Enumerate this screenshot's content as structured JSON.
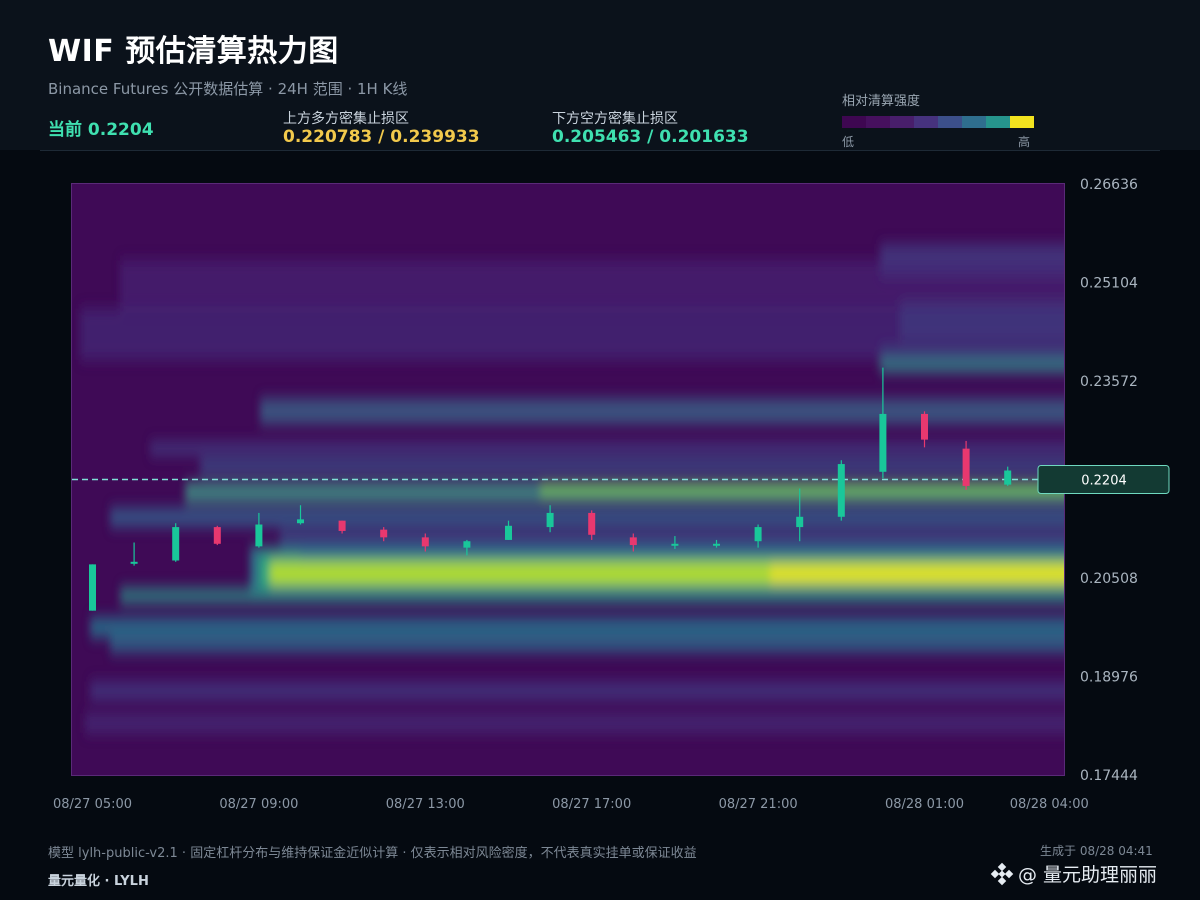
{
  "header": {
    "title": "WIF 预估清算热力图",
    "subtitle": "Binance Futures 公开数据估算 · 24H 范围 · 1H K线",
    "current": "当前 0.2204",
    "upper_zone_label": "上方多方密集止损区",
    "upper_zone_value": "0.220783 / 0.239933",
    "lower_zone_label": "下方空方密集止损区",
    "lower_zone_value": "0.205463 / 0.201633"
  },
  "legend": {
    "title": "相对清算强度",
    "low": "低",
    "high": "高",
    "colors": [
      "#3e0751",
      "#46105e",
      "#481e6b",
      "#46327e",
      "#3c4f8a",
      "#2f6e8e",
      "#26948c",
      "#f3e31f"
    ]
  },
  "colors": {
    "up_candle": "#19c79a",
    "down_candle": "#e8386f",
    "current_line": "#7fe0d6",
    "upper_zone_text": "#f2c94c",
    "lower_zone_text": "#3fe0b0"
  },
  "chart_data": {
    "type": "heatmap",
    "overlay": "candlestick",
    "ylim": [
      0.17444,
      0.26636
    ],
    "y_ticks": [
      "0.26636",
      "0.25104",
      "0.23572",
      "0.20508",
      "0.18976",
      "0.17444"
    ],
    "x_ticks": [
      "08/27 05:00",
      "08/27 09:00",
      "08/27 13:00",
      "08/27 17:00",
      "08/27 21:00",
      "08/28 01:00",
      "08/28 04:00"
    ],
    "x_range_hours": [
      0,
      23.5
    ],
    "current_price": 0.2204,
    "current_price_label": "0.2204",
    "candles": [
      {
        "o": 0.2,
        "h": 0.2072,
        "l": 0.2,
        "c": 0.2072
      },
      {
        "o": 0.2074,
        "h": 0.2106,
        "l": 0.207,
        "c": 0.2076
      },
      {
        "o": 0.2078,
        "h": 0.2136,
        "l": 0.2076,
        "c": 0.213
      },
      {
        "o": 0.213,
        "h": 0.2132,
        "l": 0.2102,
        "c": 0.2104
      },
      {
        "o": 0.21,
        "h": 0.2152,
        "l": 0.2098,
        "c": 0.2134
      },
      {
        "o": 0.2136,
        "h": 0.2164,
        "l": 0.2134,
        "c": 0.2142
      },
      {
        "o": 0.214,
        "h": 0.214,
        "l": 0.212,
        "c": 0.2124
      },
      {
        "o": 0.2126,
        "h": 0.213,
        "l": 0.2108,
        "c": 0.2114
      },
      {
        "o": 0.2114,
        "h": 0.212,
        "l": 0.2092,
        "c": 0.21
      },
      {
        "o": 0.2098,
        "h": 0.211,
        "l": 0.2086,
        "c": 0.2108
      },
      {
        "o": 0.211,
        "h": 0.214,
        "l": 0.211,
        "c": 0.2132
      },
      {
        "o": 0.213,
        "h": 0.2164,
        "l": 0.2122,
        "c": 0.2152
      },
      {
        "o": 0.2152,
        "h": 0.2156,
        "l": 0.211,
        "c": 0.2118
      },
      {
        "o": 0.2114,
        "h": 0.212,
        "l": 0.2092,
        "c": 0.2102
      },
      {
        "o": 0.2102,
        "h": 0.2116,
        "l": 0.2096,
        "c": 0.2104
      },
      {
        "o": 0.2102,
        "h": 0.211,
        "l": 0.2098,
        "c": 0.2104
      },
      {
        "o": 0.2108,
        "h": 0.2134,
        "l": 0.2098,
        "c": 0.213
      },
      {
        "o": 0.213,
        "h": 0.219,
        "l": 0.2108,
        "c": 0.2146
      },
      {
        "o": 0.2146,
        "h": 0.2234,
        "l": 0.214,
        "c": 0.2228
      },
      {
        "o": 0.2216,
        "h": 0.2378,
        "l": 0.2206,
        "c": 0.2306
      },
      {
        "o": 0.2306,
        "h": 0.231,
        "l": 0.2254,
        "c": 0.2266
      },
      {
        "o": 0.2252,
        "h": 0.2264,
        "l": 0.2188,
        "c": 0.2194
      },
      {
        "o": 0.2196,
        "h": 0.2224,
        "l": 0.2194,
        "c": 0.2218
      }
    ]
  },
  "footer": {
    "note": "模型 lylh-public-v2.1 · 固定杠杆分布与维持保证金近似计算 · 仅表示相对风险密度，不代表真实挂单或保证收益",
    "brand": "量元量化 · LYLH",
    "generated": "生成于 08/28 04:41",
    "watermark": "@ 量元助理丽丽"
  }
}
